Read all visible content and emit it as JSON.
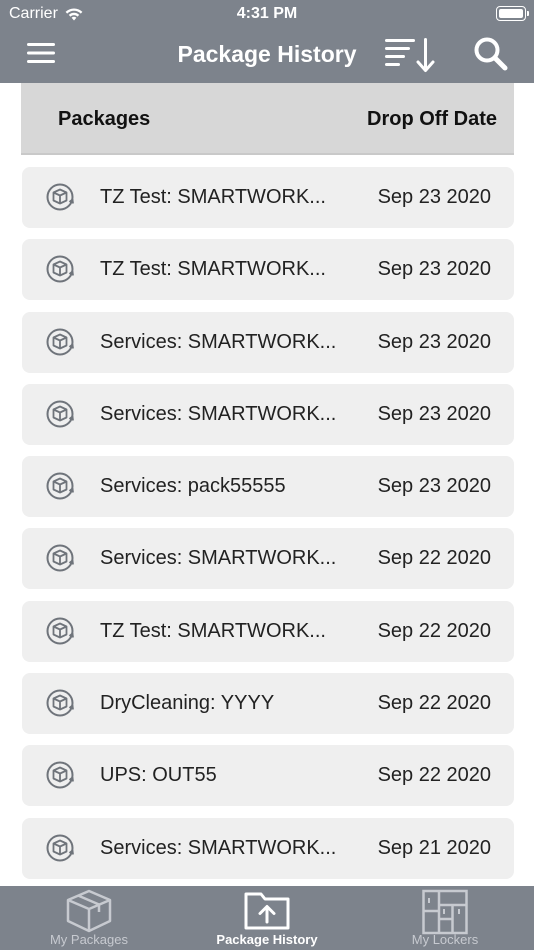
{
  "status_bar": {
    "carrier": "Carrier",
    "time": "4:31 PM"
  },
  "nav": {
    "title": "Package History",
    "menu_icon": "hamburger-menu-icon",
    "sort_icon": "sort-descending-icon",
    "search_icon": "search-icon"
  },
  "table_header": {
    "packages": "Packages",
    "drop_off_date": "Drop Off Date"
  },
  "rows": [
    {
      "name": "TZ Test: SMARTWORK...",
      "date": "Sep 23 2020"
    },
    {
      "name": "TZ Test: SMARTWORK...",
      "date": "Sep 23 2020"
    },
    {
      "name": "Services: SMARTWORK...",
      "date": "Sep 23 2020"
    },
    {
      "name": "Services: SMARTWORK...",
      "date": "Sep 23 2020"
    },
    {
      "name": "Services: pack55555",
      "date": "Sep 23 2020"
    },
    {
      "name": "Services: SMARTWORK...",
      "date": "Sep 22 2020"
    },
    {
      "name": "TZ Test: SMARTWORK...",
      "date": "Sep 22 2020"
    },
    {
      "name": "DryCleaning: YYYY",
      "date": "Sep 22 2020"
    },
    {
      "name": "UPS: OUT55",
      "date": "Sep 22 2020"
    },
    {
      "name": "Services: SMARTWORK...",
      "date": "Sep 21 2020"
    }
  ],
  "tabs": [
    {
      "label": "My Packages",
      "icon": "package-box-icon",
      "active": false
    },
    {
      "label": "Package History",
      "icon": "folder-upload-icon",
      "active": true
    },
    {
      "label": "My Lockers",
      "icon": "lockers-icon",
      "active": false
    }
  ],
  "colors": {
    "bar": "#7d838c",
    "row_bg": "#efefef",
    "header_bg": "#d7d7d7",
    "text": "#222222"
  }
}
